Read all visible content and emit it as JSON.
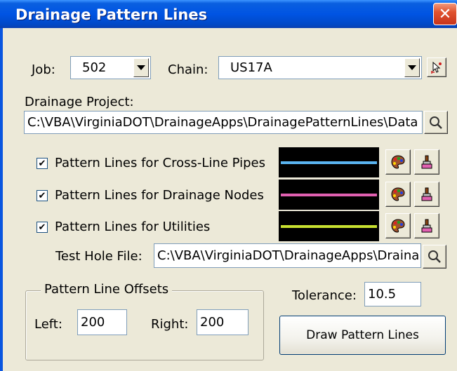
{
  "window": {
    "title": "Drainage Pattern Lines",
    "close_glyph": "✕"
  },
  "job": {
    "label": "Job:",
    "value": "502"
  },
  "chain": {
    "label": "Chain:",
    "value": "US17A"
  },
  "drainage_project": {
    "label": "Drainage Project:",
    "path": "C:\\VBA\\VirginiaDOT\\DrainageApps\\DrainagePatternLines\\Data"
  },
  "pattern_lines": [
    {
      "label": "Pattern Lines for Cross-Line Pipes",
      "checked": true,
      "line_color": "#5ab4f0"
    },
    {
      "label": "Pattern Lines for Drainage Nodes",
      "checked": true,
      "line_color": "#e060b0"
    },
    {
      "label": "Pattern Lines for Utilities",
      "checked": true,
      "line_color": "#c8e030"
    }
  ],
  "test_hole": {
    "label": "Test Hole File:",
    "path": "C:\\VBA\\VirginiaDOT\\DrainageApps\\Draina"
  },
  "offsets": {
    "group_title": "Pattern Line Offsets",
    "left_label": "Left:",
    "left_value": "200",
    "right_label": "Right:",
    "right_value": "200"
  },
  "tolerance": {
    "label": "Tolerance:",
    "value": "10.5"
  },
  "draw_button": {
    "label": "Draw Pattern Lines"
  },
  "check_glyph": "✔",
  "colors": {
    "title_bar": "#0054e3",
    "dialog_bg": "#ece9d8",
    "close_button": "#e0532f"
  }
}
